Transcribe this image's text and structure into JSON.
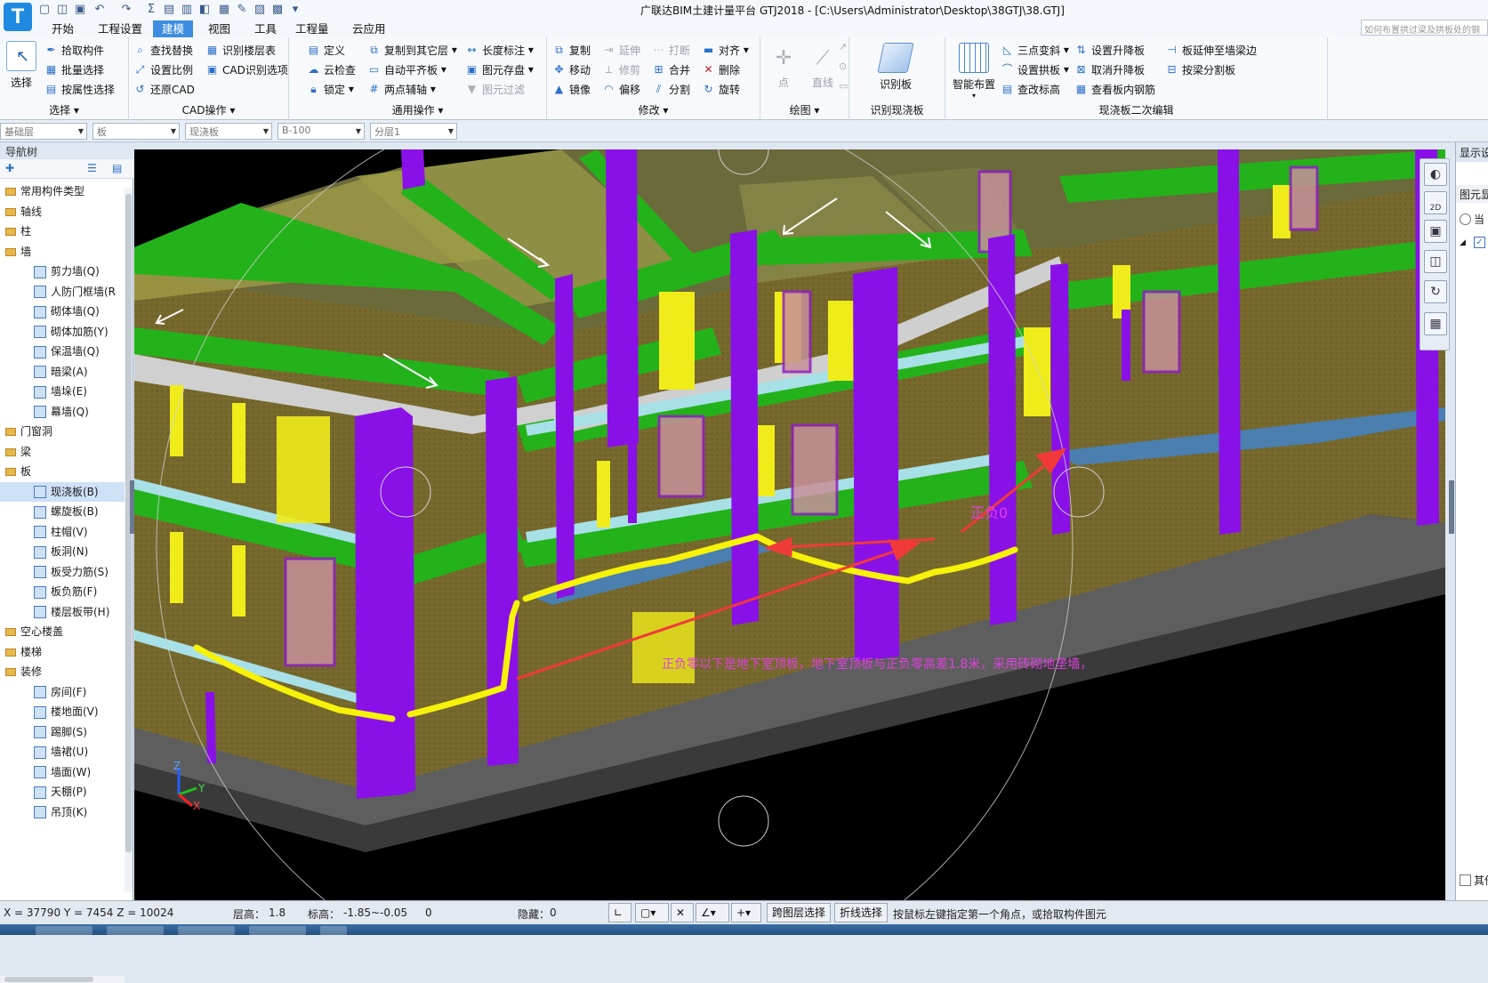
{
  "window": {
    "title": "广联达BIM土建计量平台 GTJ2018 - [C:\\Users\\Administrator\\Desktop\\38GTJ\\38.GTJ]",
    "logo_letter": "T"
  },
  "menu": {
    "tabs": [
      "开始",
      "工程设置",
      "建模",
      "视图",
      "工具",
      "工程量",
      "云应用"
    ],
    "active": "建模",
    "search_placeholder": "如何布置拱过梁及拱板处的钢"
  },
  "ribbon": {
    "select": {
      "big": "选择",
      "items": [
        "拾取构件",
        "批量选择",
        "按属性选择"
      ],
      "label": "选择"
    },
    "cad": {
      "items": [
        "查找替换",
        "识别楼层表",
        "设置比例",
        "CAD识别选项",
        "还原CAD"
      ],
      "label": "CAD操作"
    },
    "common": {
      "items": [
        "定义",
        "复制到其它层",
        "长度标注",
        "云检查",
        "自动平齐板",
        "图元存盘",
        "锁定",
        "两点辅轴",
        "图元过滤"
      ],
      "label": "通用操作"
    },
    "modify": {
      "items": [
        "复制",
        "延伸",
        "打断",
        "对齐",
        "移动",
        "修剪",
        "合并",
        "删除",
        "镜像",
        "偏移",
        "分割",
        "旋转"
      ],
      "label": "修改"
    },
    "draw": {
      "items": [
        "点",
        "直线"
      ],
      "label": "绘图"
    },
    "recognize": {
      "big": "识别板",
      "label": "识别现浇板"
    },
    "edit2": {
      "big": "智能布置",
      "items": [
        "三点变斜",
        "设置升降板",
        "板延伸至墙梁边",
        "设置拱板",
        "取消升降板",
        "按梁分割板",
        "查改标高",
        "查看板内钢筋"
      ],
      "label": "现浇板二次编辑"
    }
  },
  "propbar": {
    "floor": "基础层",
    "type": "板",
    "subtype": "现浇板",
    "name": "B-100",
    "layer": "分层1"
  },
  "nav": {
    "title": "导航树",
    "items": [
      {
        "label": "常用构件类型",
        "kind": "cat"
      },
      {
        "label": "轴线",
        "kind": "cat"
      },
      {
        "label": "柱",
        "kind": "cat"
      },
      {
        "label": "墙",
        "kind": "cat"
      },
      {
        "label": "剪力墙(Q)",
        "kind": "sub"
      },
      {
        "label": "人防门框墙(R",
        "kind": "sub"
      },
      {
        "label": "砌体墙(Q)",
        "kind": "sub"
      },
      {
        "label": "砌体加筋(Y)",
        "kind": "sub"
      },
      {
        "label": "保温墙(Q)",
        "kind": "sub"
      },
      {
        "label": "暗梁(A)",
        "kind": "sub"
      },
      {
        "label": "墙垛(E)",
        "kind": "sub"
      },
      {
        "label": "幕墙(Q)",
        "kind": "sub"
      },
      {
        "label": "门窗洞",
        "kind": "cat"
      },
      {
        "label": "梁",
        "kind": "cat"
      },
      {
        "label": "板",
        "kind": "cat"
      },
      {
        "label": "现浇板(B)",
        "kind": "sub",
        "selected": true
      },
      {
        "label": "螺旋板(B)",
        "kind": "sub"
      },
      {
        "label": "柱帽(V)",
        "kind": "sub"
      },
      {
        "label": "板洞(N)",
        "kind": "sub"
      },
      {
        "label": "板受力筋(S)",
        "kind": "sub"
      },
      {
        "label": "板负筋(F)",
        "kind": "sub"
      },
      {
        "label": "楼层板带(H)",
        "kind": "sub"
      },
      {
        "label": "空心楼盖",
        "kind": "cat"
      },
      {
        "label": "楼梯",
        "kind": "cat"
      },
      {
        "label": "装修",
        "kind": "cat"
      },
      {
        "label": "房间(F)",
        "kind": "sub"
      },
      {
        "label": "楼地面(V)",
        "kind": "sub"
      },
      {
        "label": "踢脚(S)",
        "kind": "sub"
      },
      {
        "label": "墙裙(U)",
        "kind": "sub"
      },
      {
        "label": "墙面(W)",
        "kind": "sub"
      },
      {
        "label": "天棚(P)",
        "kind": "sub"
      },
      {
        "label": "吊顶(K)",
        "kind": "sub"
      }
    ]
  },
  "viewport": {
    "annotation_zero": "正负0",
    "annotation_note": "正负零以下是地下室顶板，地下室顶板与正负零高差1.8米，采用砖砌地垄墙，",
    "axis_labels": [
      "Z",
      "Y",
      "X"
    ]
  },
  "viewtools": {
    "btn_2d": "2D"
  },
  "rightpanel": {
    "tab1": "显示设",
    "tab2": "图元显",
    "row1": "当",
    "row2": "其他"
  },
  "status": {
    "coords": "X = 37790 Y = 7454 Z = 10024",
    "floor_height_label": "层高：",
    "floor_height": "1.8",
    "elevation_label": "标高：",
    "elevation": "-1.85~-0.05",
    "count": "0",
    "hidden_label": "隐藏：",
    "hidden": "0",
    "btn_cross_layer": "跨图层选择",
    "btn_polyline": "折线选择",
    "hint": "按鼠标左键指定第一个角点，或拾取构件图元"
  }
}
